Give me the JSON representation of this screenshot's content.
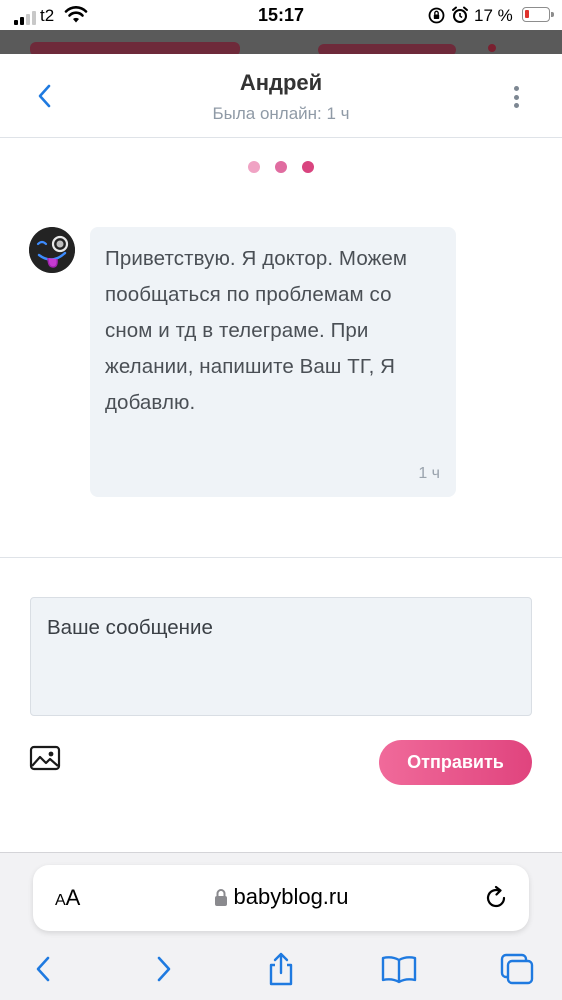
{
  "status_bar": {
    "carrier": "t2",
    "time": "15:17",
    "battery_percent": "17 %",
    "battery_level": 0.17
  },
  "chat": {
    "contact_name": "Андрей",
    "contact_status": "Была онлайн: 1 ч",
    "loader_colors": [
      "#f0a3c4",
      "#e06ca0",
      "#d9447f"
    ],
    "messages": [
      {
        "text": "Приветствую. Я доктор. Можем пообщаться по проблемам со сном и тд в телеграме. При желании, напишите Ваш ТГ, Я добавлю.",
        "time": "1 ч"
      }
    ]
  },
  "composer": {
    "placeholder": "Ваше сообщение",
    "send_label": "Отправить",
    "send_color": "#e4508a"
  },
  "browser": {
    "text_size_small": "A",
    "text_size_big": "A",
    "url": "babyblog.ru",
    "accent_color": "#1f7ae0"
  }
}
